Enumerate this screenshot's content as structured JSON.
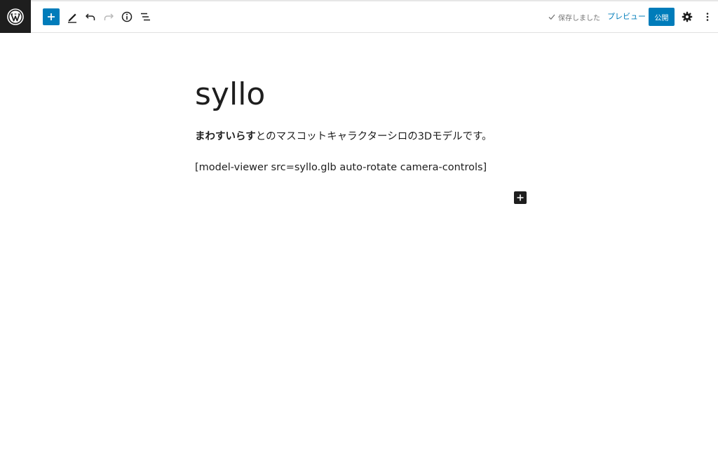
{
  "toolbar": {
    "logo_icon": "wordpress-logo-icon",
    "add_block_icon": "plus-icon",
    "tools_icon": "pencil-icon",
    "undo_icon": "undo-icon",
    "redo_icon": "redo-icon",
    "details_icon": "info-icon",
    "outline_icon": "list-view-icon",
    "saved_label": "保存しました",
    "preview_label": "プレビュー",
    "publish_label": "公開",
    "settings_icon": "gear-icon",
    "more_icon": "more-vertical-icon",
    "accent_color": "#007cba"
  },
  "editor": {
    "title": "syllo",
    "paragraph_bold": "まわすいらす",
    "paragraph_rest": "とのマスコットキャラクターシロの3Dモデルです。",
    "shortcode": "[model-viewer src=syllo.glb auto-rotate camera-controls]",
    "inserter_icon": "plus-icon"
  }
}
